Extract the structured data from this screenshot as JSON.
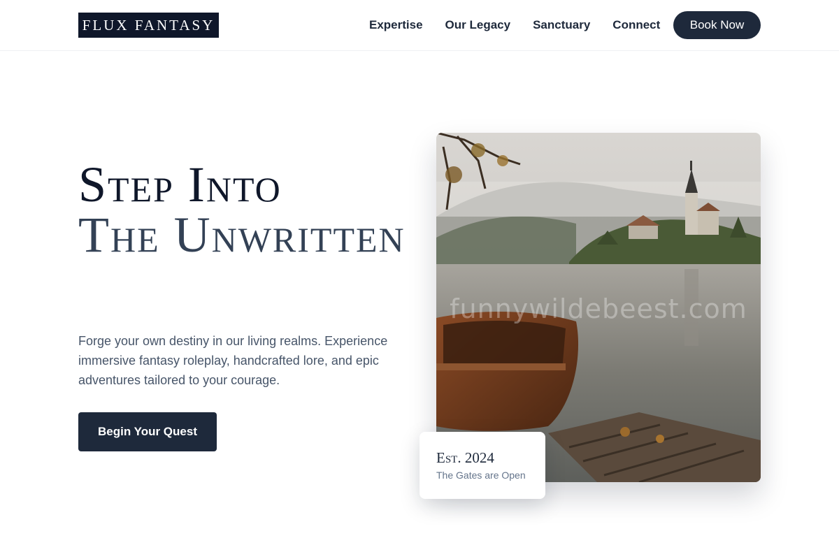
{
  "header": {
    "logo_text": "FLUX FANTASY",
    "nav": [
      {
        "label": "Expertise"
      },
      {
        "label": "Our Legacy"
      },
      {
        "label": "Sanctuary"
      },
      {
        "label": "Connect"
      }
    ],
    "cta_label": "Book Now"
  },
  "hero": {
    "title_line1": "Step Into",
    "title_line2": "The Unwritten",
    "description": "Forge your own destiny in our living realms. Experience immersive fantasy roleplay, handcrafted lore, and epic adventures tailored to your courage.",
    "cta_label": "Begin Your Quest",
    "image_watermark": "funnywildebeest.com"
  },
  "badge": {
    "year": "Est. 2024",
    "subtitle": "The Gates are Open"
  },
  "colors": {
    "primary_dark": "#1e293b",
    "logo_bg": "#0f172a",
    "text_muted": "#475569"
  }
}
